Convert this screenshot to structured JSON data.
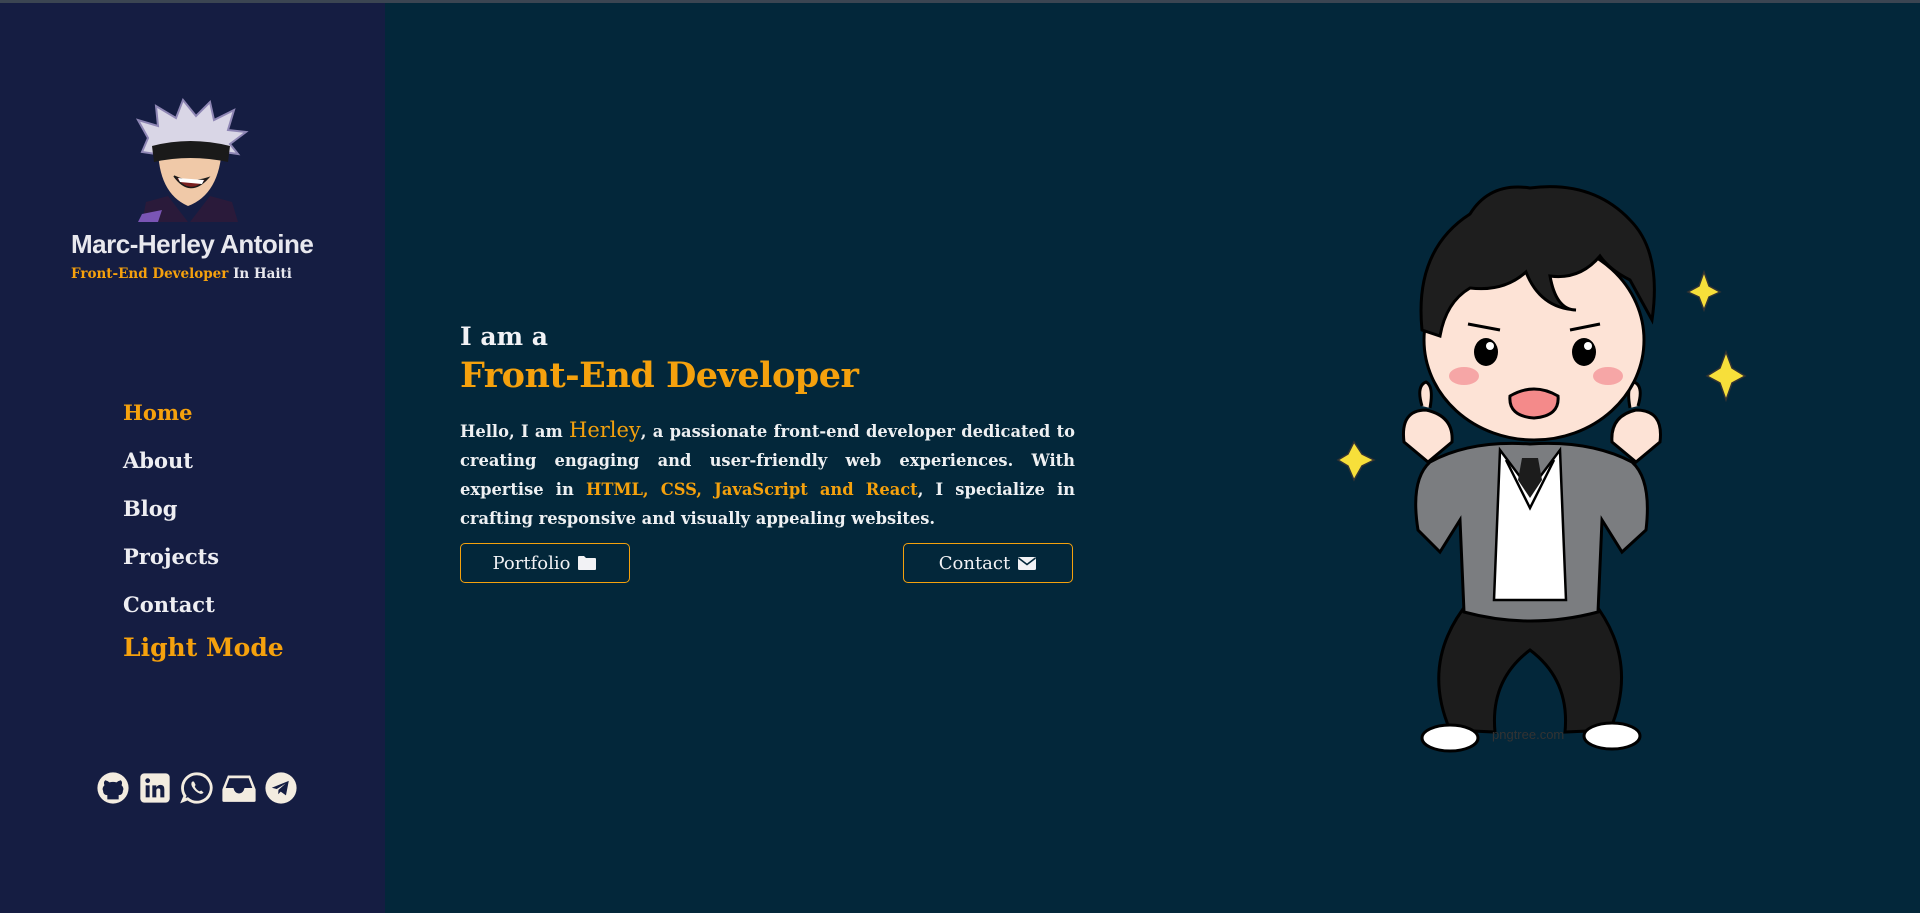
{
  "profile": {
    "name": "Marc-Herley Antoine",
    "role": "Front-End Developer",
    "location": " In Haiti",
    "avatar_icon": "anime-avatar"
  },
  "nav": {
    "items": [
      {
        "label": "Home",
        "active": true
      },
      {
        "label": "About",
        "active": false
      },
      {
        "label": "Blog",
        "active": false
      },
      {
        "label": "Projects",
        "active": false
      },
      {
        "label": "Contact",
        "active": false
      }
    ],
    "mode_toggle": "Light Mode"
  },
  "socials": [
    "github-icon",
    "linkedin-icon",
    "whatsapp-icon",
    "inbox-icon",
    "telegram-icon"
  ],
  "hero": {
    "small": "I am a",
    "big": "Front-End Developer",
    "intro_pre": "Hello, I am ",
    "intro_name": "Herley",
    "intro_mid": ", a passionate front-end developer dedicated to creating engaging and user-friendly web experiences. With expertise in ",
    "intro_skills": "HTML, CSS, JavaScript and React",
    "intro_post": ", I specialize in crafting responsive and visually appealing websites."
  },
  "buttons": {
    "portfolio": "Portfolio",
    "portfolio_icon": "folder-icon",
    "contact": "Contact",
    "contact_icon": "envelope-icon"
  },
  "illustration": {
    "watermark": "pngtree.com"
  },
  "colors": {
    "accent": "#f5a10d",
    "sidebar_bg": "#151d42",
    "main_bg": "#03273a",
    "text": "#eef0f2"
  }
}
